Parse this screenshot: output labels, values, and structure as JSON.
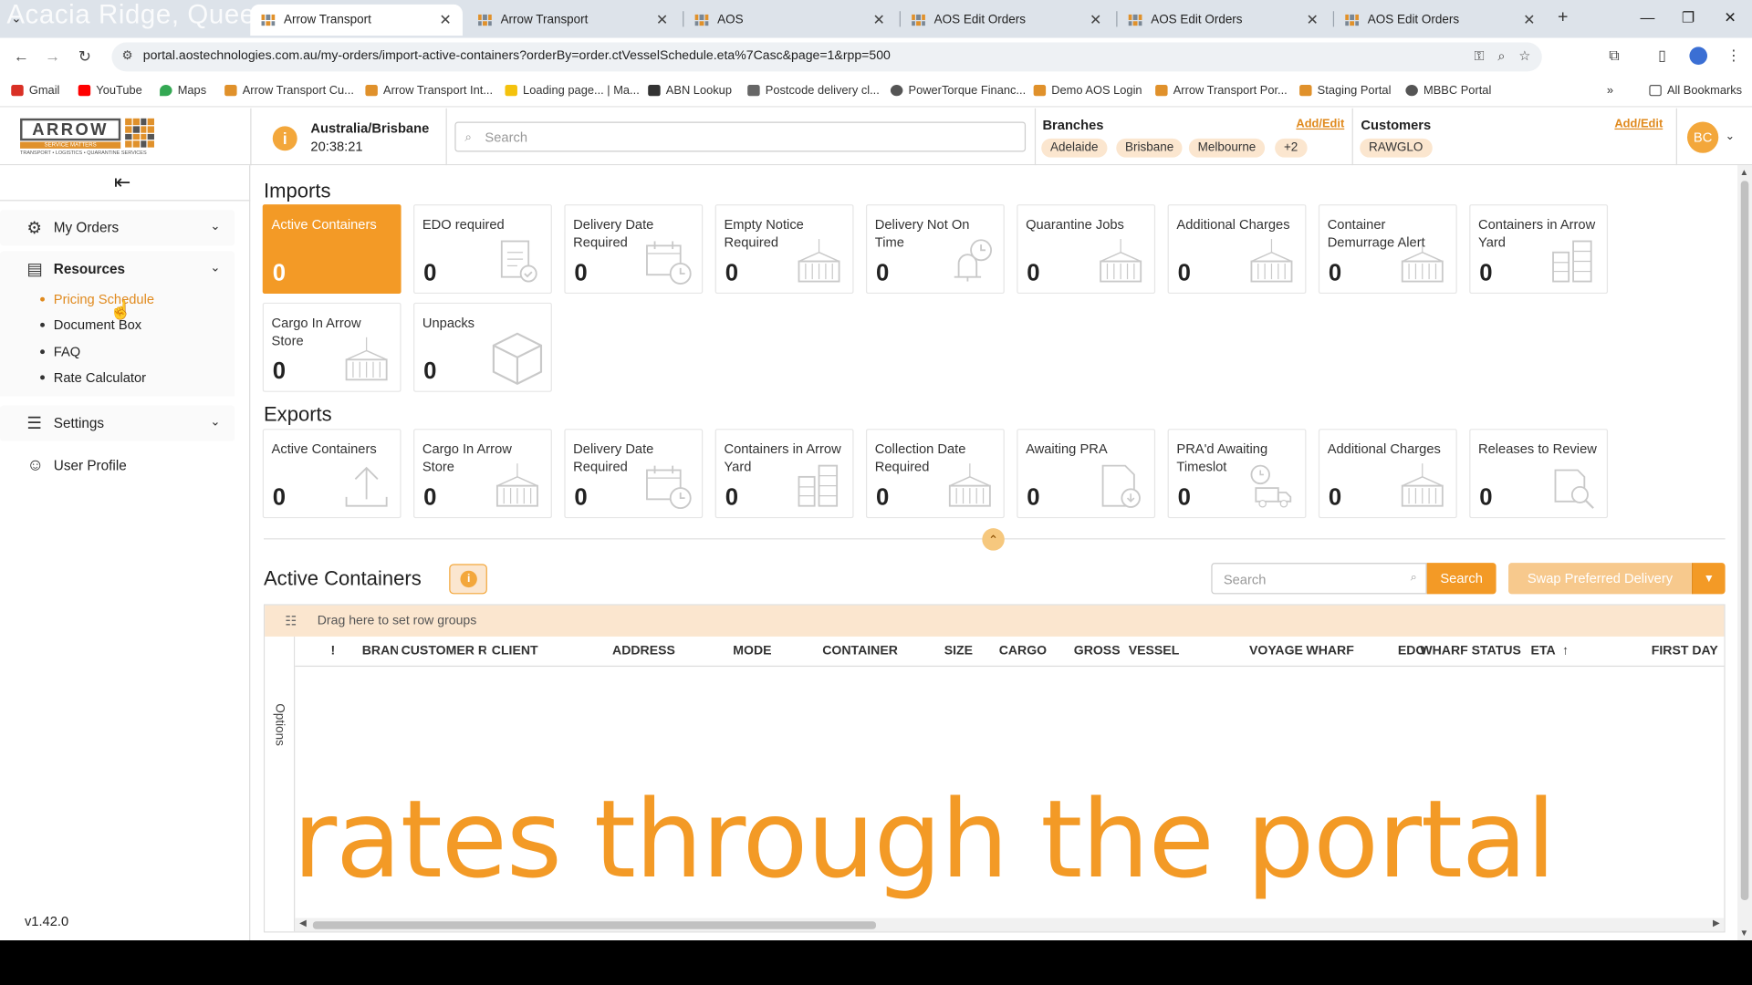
{
  "browser": {
    "ghost_title": "Acacia Ridge, Quee",
    "tabs": [
      {
        "title": "Arrow Transport",
        "active": true
      },
      {
        "title": "Arrow Transport",
        "active": false
      },
      {
        "title": "AOS",
        "active": false
      },
      {
        "title": "AOS Edit Orders",
        "active": false
      },
      {
        "title": "AOS Edit Orders",
        "active": false
      },
      {
        "title": "AOS Edit Orders",
        "active": false
      }
    ],
    "url": "portal.aostechnologies.com.au/my-orders/import-active-containers?orderBy=order.ctVesselSchedule.eta%7Casc&page=1&rpp=500",
    "bookmarks": [
      {
        "label": "Gmail",
        "color": "#d93025"
      },
      {
        "label": "YouTube",
        "color": "#ff0000"
      },
      {
        "label": "Maps",
        "color": "#34a853"
      },
      {
        "label": "Arrow Transport Cu...",
        "color": "#e0912b"
      },
      {
        "label": "Arrow Transport Int...",
        "color": "#e0912b"
      },
      {
        "label": "Loading page... | Ma...",
        "color": "#f4c20d"
      },
      {
        "label": "ABN Lookup",
        "color": "#333333"
      },
      {
        "label": "Postcode delivery cl...",
        "color": "#666666"
      },
      {
        "label": "PowerTorque Financ...",
        "color": "#555555"
      },
      {
        "label": "Demo AOS Login",
        "color": "#e0912b"
      },
      {
        "label": "Arrow Transport Por...",
        "color": "#e0912b"
      },
      {
        "label": "Staging Portal",
        "color": "#e0912b"
      },
      {
        "label": "MBBC Portal",
        "color": "#555555"
      }
    ],
    "all_bookmarks": "All Bookmarks"
  },
  "header": {
    "logo_word": "ARROW",
    "logo_tag": "SERVICE MATTERS",
    "logo_sub": "TRANSPORT • LOGISTICS • QUARANTINE SERVICES",
    "timezone": "Australia/Brisbane",
    "time": "20:38:21",
    "search_placeholder": "Search",
    "branches_title": "Branches",
    "branches_link": "Add/Edit",
    "branches": [
      "Adelaide",
      "Brisbane",
      "Melbourne",
      "+2"
    ],
    "customers_title": "Customers",
    "customers_link": "Add/Edit",
    "customers": [
      "RAWGLO"
    ],
    "user_initials": "BC"
  },
  "sidebar": {
    "groups": [
      {
        "label": "My Orders",
        "icon": "gear-icon"
      },
      {
        "label": "Resources",
        "icon": "printer-icon",
        "bold": true
      },
      {
        "label": "Settings",
        "icon": "database-icon"
      },
      {
        "label": "User Profile",
        "icon": "user-icon"
      }
    ],
    "resources_items": [
      {
        "label": "Pricing Schedule",
        "active": true
      },
      {
        "label": "Document Box",
        "active": false
      },
      {
        "label": "FAQ",
        "active": false
      },
      {
        "label": "Rate Calculator",
        "active": false
      }
    ],
    "version": "v1.42.0"
  },
  "imports": {
    "title": "Imports",
    "cards": [
      {
        "title": "Active Containers",
        "value": "0",
        "active": true,
        "icon": "none"
      },
      {
        "title": "EDO required",
        "value": "0",
        "icon": "document-check-icon"
      },
      {
        "title": "Delivery Date Required",
        "value": "0",
        "icon": "calendar-clock-icon"
      },
      {
        "title": "Empty Notice Required",
        "value": "0",
        "icon": "container-icon"
      },
      {
        "title": "Delivery Not On Time",
        "value": "0",
        "icon": "bell-clock-icon"
      },
      {
        "title": "Quarantine Jobs",
        "value": "0",
        "icon": "container-icon"
      },
      {
        "title": "Additional Charges",
        "value": "0",
        "icon": "container-icon"
      },
      {
        "title": "Container Demurrage Alert",
        "value": "0",
        "icon": "container-icon"
      },
      {
        "title": "Containers in Arrow Yard",
        "value": "0",
        "icon": "stack-icon"
      },
      {
        "title": "Cargo In Arrow Store",
        "value": "0",
        "icon": "container-icon"
      },
      {
        "title": "Unpacks",
        "value": "0",
        "icon": "box-icon"
      }
    ]
  },
  "exports": {
    "title": "Exports",
    "cards": [
      {
        "title": "Active Containers",
        "value": "0",
        "icon": "upload-arrow-icon"
      },
      {
        "title": "Cargo In Arrow Store",
        "value": "0",
        "icon": "container-icon"
      },
      {
        "title": "Delivery Date Required",
        "value": "0",
        "icon": "calendar-clock-icon"
      },
      {
        "title": "Containers in Arrow Yard",
        "value": "0",
        "icon": "stack-icon"
      },
      {
        "title": "Collection Date Required",
        "value": "0",
        "icon": "container-icon"
      },
      {
        "title": "Awaiting PRA",
        "value": "0",
        "icon": "document-download-icon"
      },
      {
        "title": "PRA'd Awaiting Timeslot",
        "value": "0",
        "icon": "truck-clock-icon"
      },
      {
        "title": "Additional Charges",
        "value": "0",
        "icon": "container-icon"
      },
      {
        "title": "Releases to Review",
        "value": "0",
        "icon": "document-search-icon"
      }
    ]
  },
  "active_containers": {
    "title": "Active Containers",
    "search_placeholder": "Search",
    "search_button": "Search",
    "swap_button": "Swap Preferred Delivery",
    "group_bar": "Drag here to set row groups",
    "options_label": "Options",
    "columns": [
      {
        "label": "!"
      },
      {
        "label": "BRAN"
      },
      {
        "label": "CUSTOMER R"
      },
      {
        "label": "CLIENT"
      },
      {
        "label": "ADDRESS"
      },
      {
        "label": "MODE"
      },
      {
        "label": "CONTAINER"
      },
      {
        "label": "SIZE"
      },
      {
        "label": "CARGO"
      },
      {
        "label": "GROSS ("
      },
      {
        "label": "VESSEL"
      },
      {
        "label": "VOYAGE"
      },
      {
        "label": "WHARF"
      },
      {
        "label": "EDO"
      },
      {
        "label": "WHARF STATUS"
      },
      {
        "label": "ETA"
      },
      {
        "label": "FIRST DAY"
      }
    ],
    "sort_indicator": "↑"
  },
  "overlay_caption": "rates through the portal",
  "colors": {
    "accent": "#f39a26",
    "accent_light": "#fbe6cf",
    "link": "#e08a1e"
  }
}
